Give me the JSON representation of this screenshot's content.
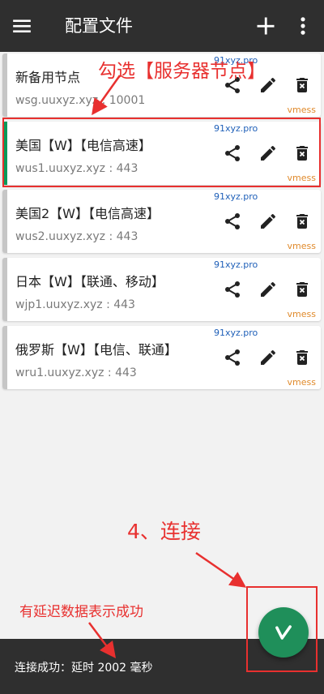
{
  "appbar": {
    "title": "配置文件"
  },
  "servers": [
    {
      "name": "新备用节点",
      "address": "wsg.uuxyz.xyz : 10001",
      "site": "91xyz.pro",
      "protocol": "vmess",
      "selected": false
    },
    {
      "name": "美国【W】【电信高速】",
      "address": "wus1.uuxyz.xyz : 443",
      "site": "91xyz.pro",
      "protocol": "vmess",
      "selected": true
    },
    {
      "name": "美国2【W】【电信高速】",
      "address": "wus2.uuxyz.xyz : 443",
      "site": "91xyz.pro",
      "protocol": "vmess",
      "selected": false
    },
    {
      "name": "日本【W】【联通、移动】",
      "address": "wjp1.uuxyz.xyz : 443",
      "site": "91xyz.pro",
      "protocol": "vmess",
      "selected": false
    },
    {
      "name": "俄罗斯【W】【电信、联通】",
      "address": "wru1.uuxyz.xyz : 443",
      "site": "91xyz.pro",
      "protocol": "vmess",
      "selected": false
    }
  ],
  "annotations": {
    "select_server": "勾选【服务器节点】",
    "connect": "4、连接",
    "latency_hint": "有延迟数据表示成功"
  },
  "status": {
    "text": "连接成功：延时 2002 毫秒"
  },
  "colors": {
    "accent_green": "#0a9a5a",
    "annotation_red": "#e8302f",
    "protocol_orange": "#e08a2b",
    "site_blue": "#1e5fb8"
  },
  "icons": {
    "menu": "menu-icon",
    "add": "plus-icon",
    "more": "more-vert-icon",
    "share": "share-icon",
    "edit": "pencil-icon",
    "delete": "trash-x-icon",
    "connect": "v-logo-icon"
  }
}
